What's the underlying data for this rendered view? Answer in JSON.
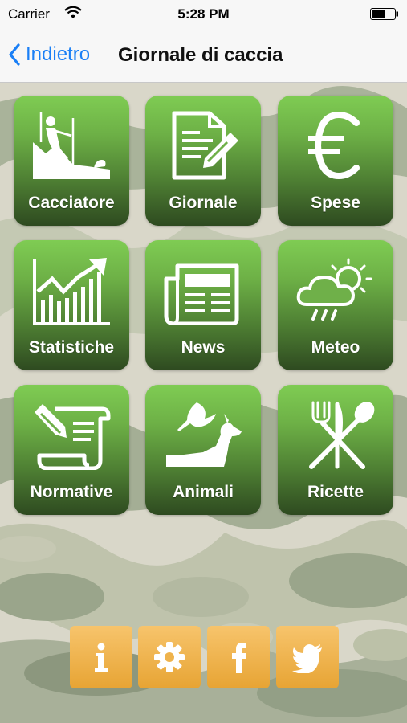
{
  "status_bar": {
    "carrier": "Carrier",
    "time": "5:28 PM"
  },
  "nav": {
    "back_label": "Indietro",
    "title": "Giornale di caccia"
  },
  "tiles": [
    {
      "label": "Cacciatore",
      "icon": "hunter-icon"
    },
    {
      "label": "Giornale",
      "icon": "journal-edit-icon"
    },
    {
      "label": "Spese",
      "icon": "euro-icon"
    },
    {
      "label": "Statistiche",
      "icon": "chart-up-icon"
    },
    {
      "label": "News",
      "icon": "newspaper-icon"
    },
    {
      "label": "Meteo",
      "icon": "weather-icon"
    },
    {
      "label": "Normative",
      "icon": "scroll-pen-icon"
    },
    {
      "label": "Animali",
      "icon": "animals-icon"
    },
    {
      "label": "Ricette",
      "icon": "fork-knife-spoon-icon"
    }
  ],
  "bottom_buttons": [
    {
      "icon": "info-icon"
    },
    {
      "icon": "settings-gear-icon"
    },
    {
      "icon": "facebook-icon"
    },
    {
      "icon": "twitter-icon"
    }
  ],
  "colors": {
    "accent": "#1a7ff6",
    "tile_top": "#7fcc53",
    "tile_bottom": "#2e4a20",
    "button": "#efb34c"
  }
}
